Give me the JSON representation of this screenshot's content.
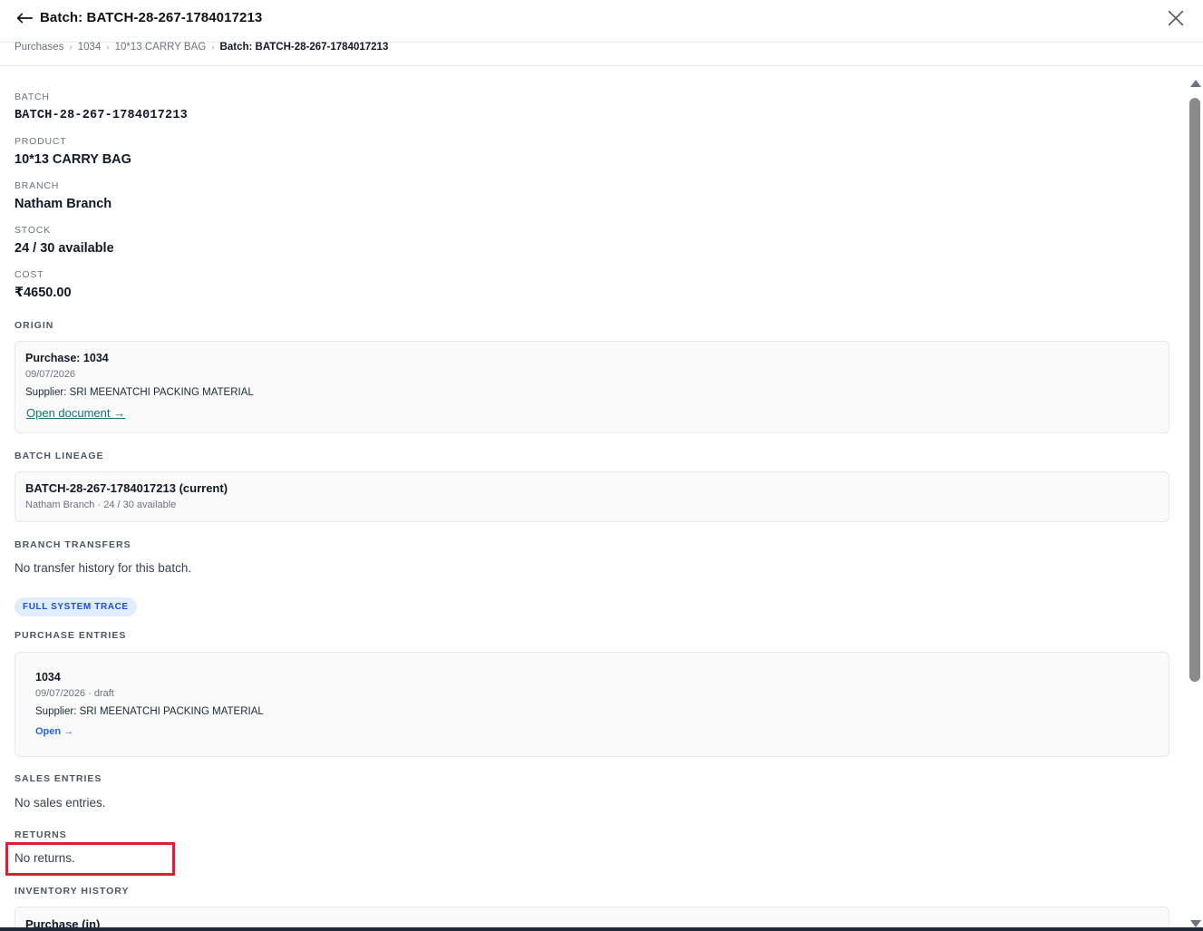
{
  "header": {
    "title": "Batch: BATCH-28-267-1784017213"
  },
  "breadcrumb": [
    "Purchases",
    "1034",
    "10*13 CARRY BAG",
    "Batch: BATCH-28-267-1784017213"
  ],
  "details": {
    "batch_label": "BATCH",
    "batch_value": "BATCH-28-267-1784017213",
    "product_label": "PRODUCT",
    "product_value": "10*13 CARRY BAG",
    "branch_label": "BRANCH",
    "branch_value": "Natham Branch",
    "stock_label": "STOCK",
    "stock_value": "24 / 30 available",
    "cost_label": "COST",
    "cost_value": "₹4650.00"
  },
  "origin": {
    "section_title": "ORIGIN",
    "title": "Purchase: 1034",
    "date": "09/07/2026",
    "supplier": "Supplier: SRI MEENATCHI PACKING MATERIAL",
    "link": "Open document →"
  },
  "lineage": {
    "section_title": "BATCH LINEAGE",
    "title": "BATCH-28-267-1784017213 (current)",
    "subtitle": "Natham Branch · 24 / 30 available"
  },
  "transfers": {
    "section_title": "BRANCH TRANSFERS",
    "empty_text": "No transfer history for this batch."
  },
  "trace_pill": "FULL SYSTEM TRACE",
  "purchase_entries": {
    "section_title": "PURCHASE ENTRIES",
    "title": "1034",
    "meta": "09/07/2026 · draft",
    "supplier": "Supplier: SRI MEENATCHI PACKING MATERIAL",
    "link": "Open →"
  },
  "sales_entries": {
    "section_title": "SALES ENTRIES",
    "empty_text": "No sales entries."
  },
  "returns": {
    "section_title": "RETURNS",
    "empty_text": "No returns."
  },
  "inventory_history": {
    "section_title": "INVENTORY HISTORY",
    "first_item_title": "Purchase (in)"
  },
  "icons": {
    "back": "arrow-left-icon",
    "close": "close-icon"
  }
}
